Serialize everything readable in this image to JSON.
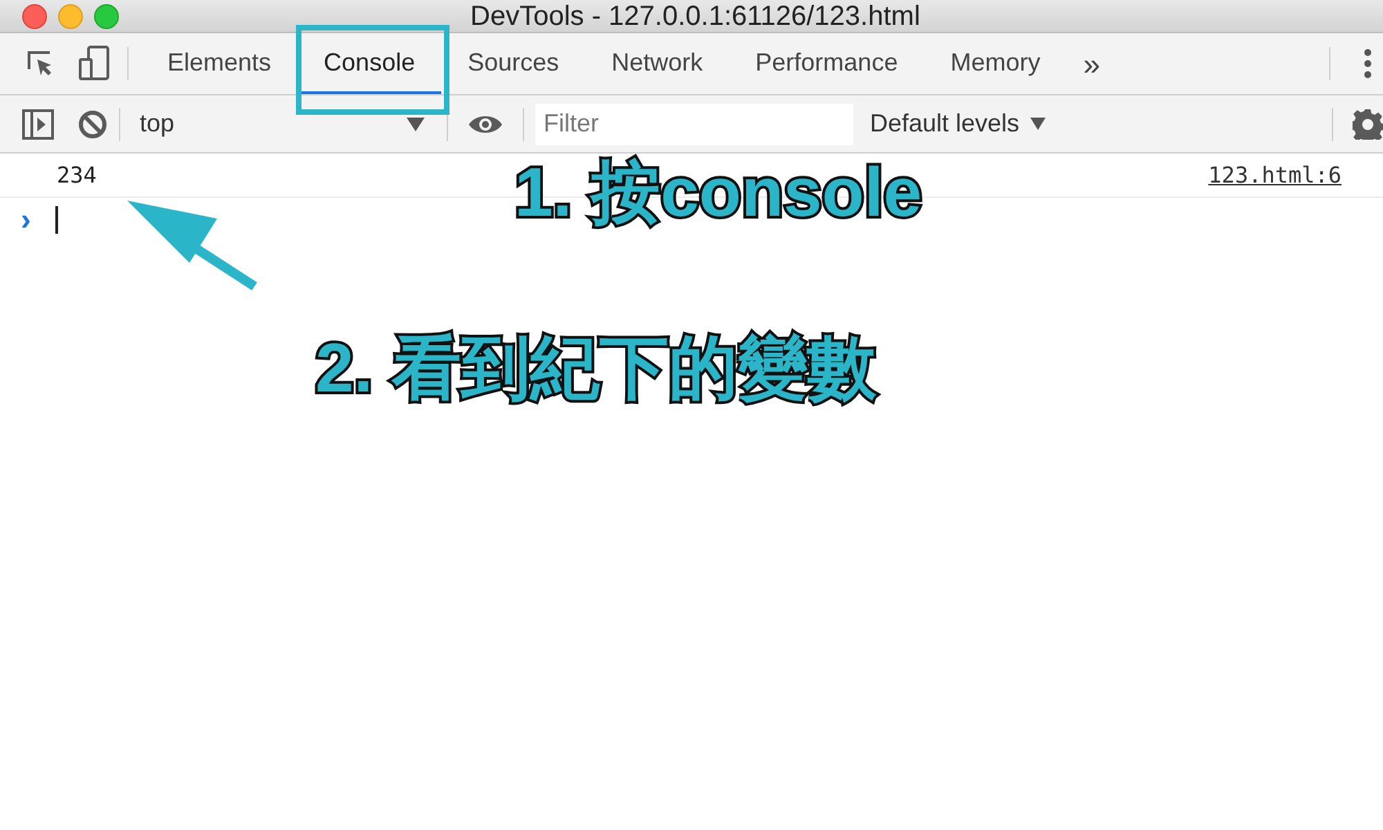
{
  "window": {
    "title": "DevTools - 127.0.0.1:61126/123.html"
  },
  "tabs": [
    {
      "label": "Elements",
      "selected": false,
      "highlighted": false
    },
    {
      "label": "Console",
      "selected": true,
      "highlighted": true
    },
    {
      "label": "Sources",
      "selected": false,
      "highlighted": false
    },
    {
      "label": "Network",
      "selected": false,
      "highlighted": false
    },
    {
      "label": "Performance",
      "selected": false,
      "highlighted": false
    },
    {
      "label": "Memory",
      "selected": false,
      "highlighted": false
    }
  ],
  "more_tabs": "»",
  "toolbar": {
    "context": "top",
    "filter": {
      "placeholder": "Filter"
    },
    "levels": "Default levels"
  },
  "console": {
    "messages": [
      {
        "text": "234",
        "source": "123.html:6"
      }
    ],
    "prompt": "›"
  },
  "annotations": [
    {
      "text": "1. 按console"
    },
    {
      "text": "2. 看到紀下的變數"
    }
  ]
}
